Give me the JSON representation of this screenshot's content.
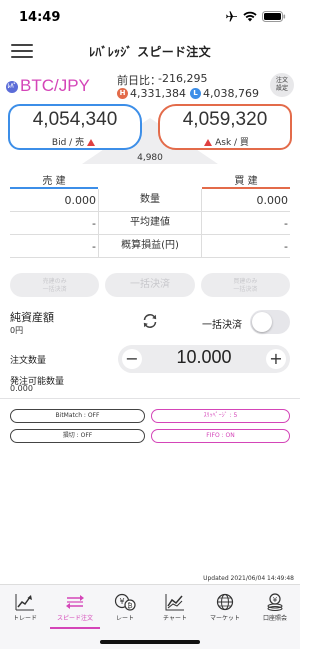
{
  "status_bar": {
    "time": "14:49"
  },
  "header": {
    "title": "ﾚﾊﾞﾚｯｼﾞ スピード注文"
  },
  "pair": {
    "badge": "ﾚﾊﾞ",
    "name": "BTC/JPY",
    "prev_label": "前日比：",
    "prev_value": "-216,295",
    "high_badge": "H",
    "high": "4,331,384",
    "low_badge": "L",
    "low": "4,038,769",
    "settings_label_1": "注文",
    "settings_label_2": "設定"
  },
  "prices": {
    "bid": "4,054,340",
    "bid_label": "Bid / 売",
    "ask": "4,059,320",
    "ask_label": "Ask / 買",
    "spread": "4,980",
    "colors": {
      "bid": "#3c8ee8",
      "ask": "#e36b4a",
      "up_arrow": "#e04040"
    }
  },
  "positions": {
    "sell_header": "売 建",
    "buy_header": "買 建",
    "rows": [
      {
        "sell": "0.000",
        "label": "数量",
        "buy": "0.000"
      },
      {
        "sell": "-",
        "label": "平均建値",
        "buy": "-"
      },
      {
        "sell": "-",
        "label": "概算損益(円)",
        "buy": "-"
      }
    ]
  },
  "bulk_buttons": {
    "sell_line1": "売建のみ",
    "sell_line2": "一括決済",
    "all": "一括決済",
    "buy_line1": "買建のみ",
    "buy_line2": "一括決済"
  },
  "net": {
    "label": "純資産額",
    "value": "0円",
    "bulk_toggle_label": "一括決済",
    "bulk_toggle_on": false
  },
  "order": {
    "qty_label": "注文数量",
    "qty_value": "10.000",
    "minus": "−",
    "plus": "+",
    "avail_label": "発注可能数量",
    "avail_value": "0.000"
  },
  "settings": {
    "bitmatch": "BitMatch : OFF",
    "slippage": "ｽﾘｯﾍﾟｰｼﾞ : 5",
    "stop": "損切 : OFF",
    "fifo": "FIFO : ON",
    "accent": "#d445b8"
  },
  "updated": "Updated   2021/06/04 14:49:48",
  "tabs": [
    {
      "label": "トレード",
      "icon": "trend-chart-icon"
    },
    {
      "label": "スピード注文",
      "icon": "speed-order-icon"
    },
    {
      "label": "レート",
      "icon": "currency-rate-icon"
    },
    {
      "label": "チャート",
      "icon": "line-chart-icon"
    },
    {
      "label": "マーケット",
      "icon": "globe-icon"
    },
    {
      "label": "口座照会",
      "icon": "account-coins-icon"
    }
  ]
}
